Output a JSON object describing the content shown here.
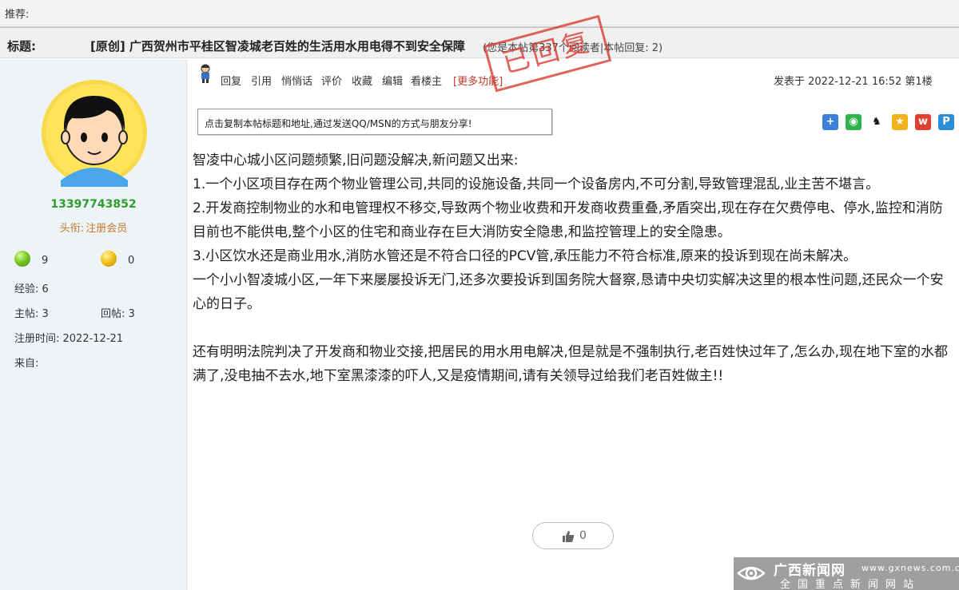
{
  "topbar": {
    "recommend_label": "推荐:"
  },
  "thread": {
    "title_label": "标题:",
    "title": "[原创] 广西贺州市平桂区智凌城老百姓的生活用水用电得不到安全保障",
    "meta": "(您是本帖第337个阅读者|本帖回复: 2)",
    "stamp": "已回复"
  },
  "user": {
    "name": "13397743852",
    "title_label": "头衔:",
    "title_value": "注册会员",
    "green_count": "9",
    "yellow_count": "0",
    "experience": "经验: 6",
    "posts": "主帖: 3",
    "replies": "回帖: 3",
    "reg_time": "注册时间: 2022-12-21",
    "from": "来自:"
  },
  "toolbar": {
    "reply": "回复",
    "quote": "引用",
    "whisper": "悄悄话",
    "rate": "评价",
    "favorite": "收藏",
    "edit": "编辑",
    "view_op": "看楼主",
    "more": "[更多功能]"
  },
  "post": {
    "posted_at": "发表于 2022-12-21 16:52 第1楼",
    "share_hint": "点击复制本帖标题和地址,通过发送QQ/MSN的方式与朋友分享!",
    "paragraphs": [
      "智凌中心城小区问题频繁,旧问题没解决,新问题又出来:",
      "1.一个小区项目存在两个物业管理公司,共同的设施设备,共同一个设备房内,不可分割,导致管理混乱,业主苦不堪言。",
      "2.开发商控制物业的水和电管理权不移交,导致两个物业收费和开发商收费重叠,矛盾突出,现在存在欠费停电、停水,监控和消防目前也不能供电,整个小区的住宅和商业存在巨大消防安全隐患,和监控管理上的安全隐患。",
      "3.小区饮水还是商业用水,消防水管还是不符合口径的PCV管,承压能力不符合标准,原来的投诉到现在尚未解决。",
      "一个小小智凌城小区,一年下来屡屡投诉无门,还多次要投诉到国务院大督察,恳请中央切实解决这里的根本性问题,还民众一个安心的日子。",
      "还有明明法院判决了开发商和物业交接,把居民的用水用电解决,但是就是不强制执行,老百姓快过年了,怎么办,现在地下室的水都满了,没电抽不去水,地下室黑漆漆的吓人,又是疫情期间,请有关领导过给我们老百姓做主!!"
    ],
    "like_count": "0"
  },
  "share_icons": [
    {
      "name": "add-share",
      "glyph": "+",
      "color": "#3b7fd9"
    },
    {
      "name": "wechat",
      "glyph": "◉",
      "color": "#2fb34a"
    },
    {
      "name": "qq",
      "glyph": "♞",
      "color": "#1a1a1a"
    },
    {
      "name": "qzone",
      "glyph": "★",
      "color": "#f2b21b"
    },
    {
      "name": "weibo",
      "glyph": "w",
      "color": "#e0402e"
    },
    {
      "name": "tencent-weibo",
      "glyph": "P",
      "color": "#2a8fd6"
    }
  ],
  "watermark": {
    "name": "广西新闻网",
    "url": "www.gxnews.com.cn",
    "sub": "全国重点新闻网站"
  }
}
